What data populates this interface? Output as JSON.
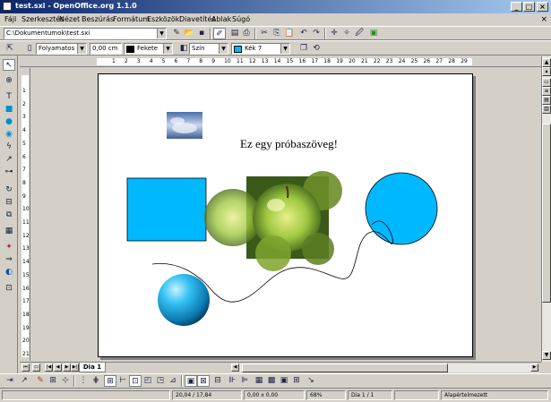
{
  "window": {
    "title": "test.sxi - OpenOffice.org 1.1.0",
    "buttons": {
      "minimize": "_",
      "maximize": "□",
      "close": "×"
    }
  },
  "menubar": {
    "items": [
      "Fájl",
      "Szerkesztés",
      "Nézet",
      "Beszúrás",
      "Formátum",
      "Eszközök",
      "Diavetítés",
      "Ablak",
      "Súgó"
    ],
    "close_doc": "×"
  },
  "function_bar": {
    "path": "C:\\Dokumentumok\\test.sxi"
  },
  "object_bar": {
    "line_style": "Folyamatos",
    "line_width": "0,00 cm",
    "line_color": "Fekete",
    "area_style": "Szín",
    "area_color": "Kék 7",
    "colors": {
      "line": "#000000",
      "area": "#00b8ff"
    }
  },
  "ruler": {
    "h_labels": [
      "1",
      "2",
      "3",
      "4",
      "5",
      "6",
      "7",
      "8",
      "9",
      "10",
      "11",
      "12",
      "13",
      "14",
      "15",
      "16",
      "17",
      "18",
      "19",
      "20",
      "21",
      "22",
      "23",
      "24",
      "25",
      "26",
      "27",
      "28",
      "29"
    ],
    "v_labels": [
      "1",
      "2",
      "3",
      "4",
      "5",
      "6",
      "7",
      "8",
      "9",
      "10",
      "11",
      "12",
      "13",
      "14",
      "15",
      "16",
      "17",
      "18",
      "19",
      "20",
      "21"
    ]
  },
  "slide": {
    "text": "Ez egy próbaszöveg!",
    "colors": {
      "rectangle": "#00b8ff",
      "circle": "#00b8ff",
      "sphere": "#0090c8"
    }
  },
  "tabs": {
    "slide_tab": "Dia 1"
  },
  "statusbar": {
    "position": "20,04 / 17,84",
    "size": "0,00 x 0,00",
    "zoom": "68%",
    "slide": "Dia 1 / 1",
    "layout": "Alapértelmezett"
  }
}
